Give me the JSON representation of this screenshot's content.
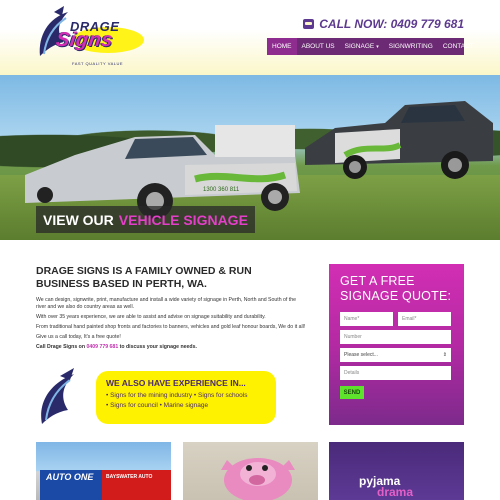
{
  "brand": {
    "name_top": "DRAGE",
    "name_main": "Signs",
    "tagline": "FAST  QUALITY  VALUE"
  },
  "header": {
    "phone": "CALL NOW: 0409 779 681"
  },
  "nav": {
    "items": [
      {
        "label": "HOME",
        "active": true
      },
      {
        "label": "ABOUT US"
      },
      {
        "label": "SIGNAGE",
        "caret": "▾"
      },
      {
        "label": "SIGNWRITING"
      },
      {
        "label": "CONTACT"
      }
    ]
  },
  "hero": {
    "caption_white": "VIEW OUR",
    "caption_pink": "VEHICLE SIGNAGE",
    "van_phone": "1300 360 811"
  },
  "intro": {
    "title": "DRAGE SIGNS IS A FAMILY OWNED & RUN BUSINESS BASED IN PERTH, WA.",
    "paragraphs": [
      "We can design, signwrite, print, manufacture and install a wide variety of signage in Perth, North and South of the river and we also do country areas as well.",
      "With over 35 years experience, we are able to assist and advise on signage suitability and durability.",
      "From traditional hand painted shop fronts and factories to banners, vehicles and gold leaf honour boards, We do it all!",
      "Give us a call today, It's a free quote!"
    ],
    "call_prefix": "Call Drage Signs on",
    "call_number": "0409 779 681",
    "call_suffix": "to discuss your signage needs."
  },
  "experience": {
    "title": "WE ALSO HAVE EXPERIENCE IN...",
    "lines": [
      "• Signs for the mining industry  • Signs for schools",
      "• Signs for council  • Marine signage"
    ]
  },
  "quote_form": {
    "title": "GET A FREE SIGNAGE QUOTE:",
    "name_placeholder": "Name*",
    "email_placeholder": "Email*",
    "number_placeholder": "Number",
    "select_value": "Please select...",
    "details_placeholder": "Details",
    "send_label": "SEND"
  },
  "gallery": {
    "auto_sign": "AUTO ONE",
    "auto_sub": "BAYSWATER AUTO",
    "pj_line1": "pyjama",
    "pj_line2": "drama"
  },
  "colors": {
    "purple": "#6b2a73",
    "magenta": "#d22eb4",
    "yellow": "#fff200",
    "green": "#5ee22c"
  }
}
